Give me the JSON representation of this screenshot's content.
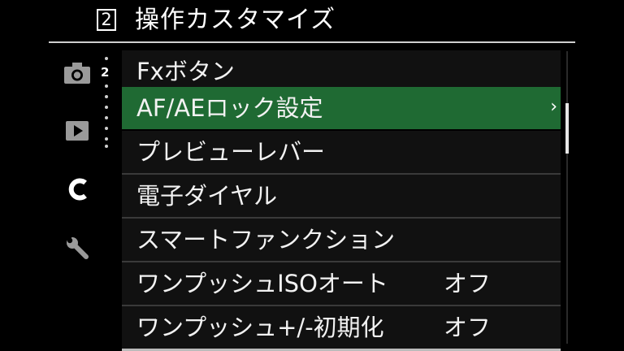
{
  "header": {
    "page_number": "2",
    "title": "操作カスタマイズ"
  },
  "sidebar": {
    "tabs": [
      {
        "name": "shooting",
        "icon": "camera-icon"
      },
      {
        "name": "playback",
        "icon": "play-icon"
      },
      {
        "name": "custom",
        "icon": "c-icon",
        "label": "C"
      },
      {
        "name": "setup",
        "icon": "wrench-icon"
      }
    ],
    "sub_page": "2"
  },
  "menu": {
    "items": [
      {
        "label": "Fxボタン",
        "value": ""
      },
      {
        "label": "AF/AEロック設定",
        "value": "",
        "selected": true,
        "arrow": "›"
      },
      {
        "label": "プレビューレバー",
        "value": ""
      },
      {
        "label": "電子ダイヤル",
        "value": ""
      },
      {
        "label": "スマートファンクション",
        "value": ""
      },
      {
        "label": "ワンプッシュISOオート",
        "value": "オフ"
      },
      {
        "label": "ワンプッシュ+/-初期化",
        "value": "オフ"
      }
    ]
  },
  "colors": {
    "background": "#000000",
    "row_background": "#111111",
    "selected_background": "#1f6a33",
    "text": "#f2f2f2",
    "icon_gray": "#9a9a9a"
  }
}
